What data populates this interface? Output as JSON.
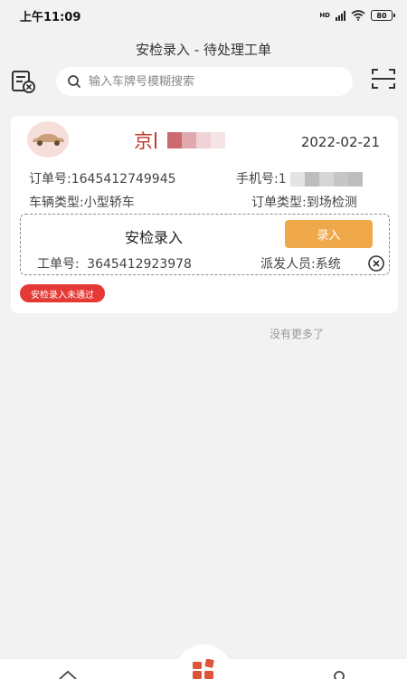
{
  "status_bar": {
    "time": "上午11:09",
    "network": "HD",
    "battery": "80"
  },
  "header": {
    "title": "安检录入 - 待处理工单"
  },
  "search": {
    "placeholder": "输入车牌号模糊搜索"
  },
  "order": {
    "plate_prefix": "京",
    "date": "2022-02-21",
    "order_no_label": "订单号:",
    "order_no": "1645412749945",
    "phone_label": "手机号:",
    "phone_visible": "1",
    "vehicle_type_label": "车辆类型:",
    "vehicle_type": "小型轿车",
    "order_type_label": "订单类型:",
    "order_type": "到场检测",
    "task": {
      "title": "安检录入",
      "button_label": "录入",
      "work_no_label": "工单号:",
      "work_no": "3645412923978",
      "dispatcher_label": "派发人员:",
      "dispatcher": "系统"
    },
    "status_badge": "安检录入未通过"
  },
  "list_end_text": "没有更多了",
  "colors": {
    "accent": "#f0a94a",
    "plate": "#c0392b",
    "badge": "#e53935"
  },
  "icons": [
    "document-x-icon",
    "search-icon",
    "scan-icon",
    "car-icon",
    "close-circle-icon",
    "home-icon",
    "grid-icon",
    "user-icon"
  ]
}
